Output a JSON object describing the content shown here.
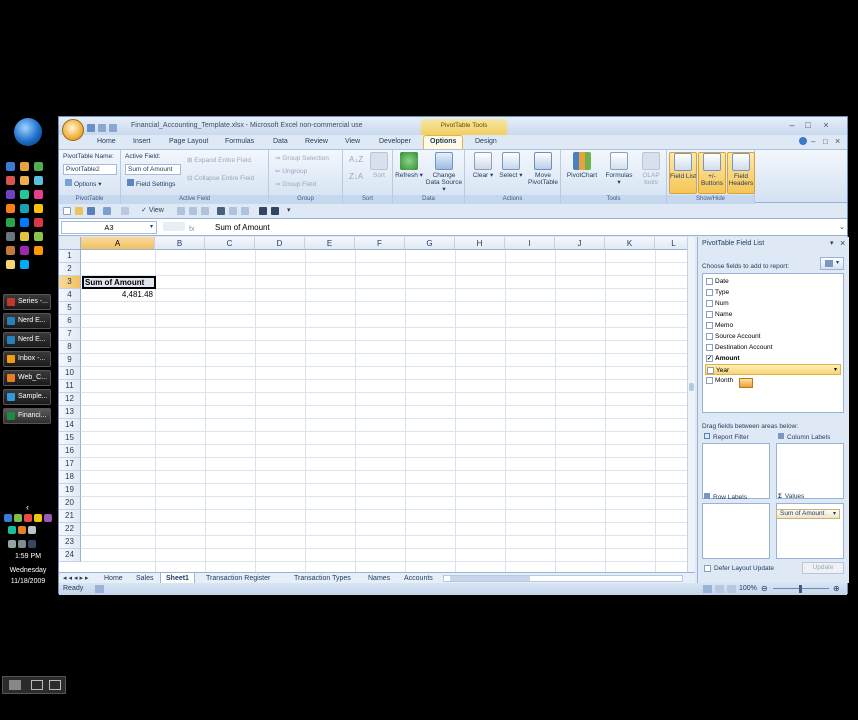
{
  "taskbar": {
    "buttons": [
      "Series -...",
      "Nerd E...",
      "Nerd E...",
      "Inbox -...",
      "Web_C...",
      "Sample...",
      "Financi..."
    ],
    "time": "1:59 PM",
    "day": "Wednesday",
    "date": "11/18/2009"
  },
  "window": {
    "title": "Financial_Accounting_Template.xlsx - Microsoft Excel non-commercial use",
    "contextual_tab": "PivotTable Tools"
  },
  "tabs": [
    "Home",
    "Insert",
    "Page Layout",
    "Formulas",
    "Data",
    "Review",
    "View",
    "Developer",
    "Options",
    "Design"
  ],
  "active_tab": "Options",
  "ribbon": {
    "pivottable": {
      "name_label": "PivotTable Name:",
      "name_value": "PivotTable2",
      "options_label": "Options",
      "group": "PivotTable"
    },
    "active_field": {
      "label": "Active Field:",
      "value": "Sum of Amount",
      "settings": "Field Settings",
      "expand": "Expand Entire Field",
      "collapse": "Collapse Entire Field",
      "group": "Active Field"
    },
    "group_grp": {
      "selection": "Group Selection",
      "ungroup": "Ungroup",
      "field": "Group Field",
      "group": "Group"
    },
    "sort": {
      "label": "Sort",
      "group": "Sort"
    },
    "data": {
      "refresh": "Refresh",
      "change": "Change Data Source",
      "group": "Data"
    },
    "actions": {
      "clear": "Clear",
      "select": "Select",
      "move": "Move PivotTable",
      "group": "Actions"
    },
    "tools": {
      "chart": "PivotChart",
      "formulas": "Formulas",
      "olap": "OLAP tools",
      "group": "Tools"
    },
    "showhide": {
      "field_list": "Field List",
      "buttons": "+/- Buttons",
      "headers": "Field Headers",
      "group": "Show/Hide"
    }
  },
  "qat": {
    "view": "View"
  },
  "formula_bar": {
    "name_box": "A3",
    "fx": "fx",
    "formula": "Sum of Amount"
  },
  "columns": [
    "A",
    "B",
    "C",
    "D",
    "E",
    "F",
    "G",
    "H",
    "I",
    "J",
    "K",
    "L"
  ],
  "rows": [
    "1",
    "2",
    "3",
    "4",
    "5",
    "6",
    "7",
    "8",
    "9",
    "10",
    "11",
    "12",
    "13",
    "14",
    "15",
    "16",
    "17",
    "18",
    "19",
    "20",
    "21",
    "22",
    "23",
    "24"
  ],
  "cells": {
    "a3": "Sum of Amount",
    "a4": "4,481.48"
  },
  "sheets": [
    "Home",
    "Sales",
    "Sheet1",
    "Transaction Register",
    "Transaction Types",
    "Names",
    "Accounts"
  ],
  "active_sheet": "Sheet1",
  "status": {
    "ready": "Ready",
    "zoom": "100%"
  },
  "field_list": {
    "title": "PivotTable Field List",
    "choose": "Choose fields to add to report:",
    "fields": [
      {
        "name": "Date",
        "checked": false
      },
      {
        "name": "Type",
        "checked": false
      },
      {
        "name": "Num",
        "checked": false
      },
      {
        "name": "Name",
        "checked": false
      },
      {
        "name": "Memo",
        "checked": false
      },
      {
        "name": "Source Account",
        "checked": false
      },
      {
        "name": "Destination Account",
        "checked": false
      },
      {
        "name": "Amount",
        "checked": true
      },
      {
        "name": "Year",
        "checked": false
      },
      {
        "name": "Month",
        "checked": false
      }
    ],
    "drag_label": "Drag fields between areas below:",
    "report_filter": "Report Filter",
    "column_labels": "Column Labels",
    "row_labels": "Row Labels",
    "values": "Values",
    "values_item": "Sum of Amount",
    "defer": "Defer Layout Update",
    "update": "Update"
  },
  "colors": {
    "accent": "#f1c15f",
    "window_bg": "#dfe9f5",
    "border": "#9ab3d4"
  }
}
